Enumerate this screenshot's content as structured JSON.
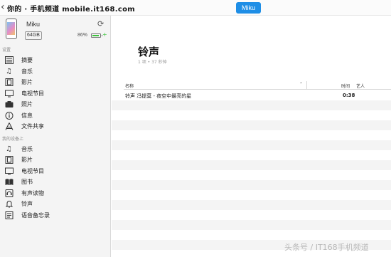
{
  "topbar": {
    "watermark": "你的 · 手机频道 mobile.it168.com",
    "device_button": "Miku"
  },
  "device": {
    "name": "Miku",
    "capacity": "64GB",
    "battery_percent": "86%",
    "battery_level": 0.86
  },
  "sidebar": {
    "settings_label": "设置",
    "settings_items": [
      {
        "label": "摘要",
        "icon": "summary-icon"
      },
      {
        "label": "音乐",
        "icon": "music-icon"
      },
      {
        "label": "影片",
        "icon": "film-icon"
      },
      {
        "label": "电视节目",
        "icon": "tv-icon"
      },
      {
        "label": "照片",
        "icon": "camera-icon"
      },
      {
        "label": "信息",
        "icon": "info-icon"
      },
      {
        "label": "文件共享",
        "icon": "apps-icon"
      }
    ],
    "ondevice_label": "我的设备上",
    "ondevice_items": [
      {
        "label": "音乐",
        "icon": "music-icon"
      },
      {
        "label": "影片",
        "icon": "film-icon"
      },
      {
        "label": "电视节目",
        "icon": "tv-icon"
      },
      {
        "label": "图书",
        "icon": "book-icon"
      },
      {
        "label": "有声读物",
        "icon": "audiobook-icon"
      },
      {
        "label": "铃声",
        "icon": "bell-icon"
      },
      {
        "label": "语音备忘录",
        "icon": "memo-icon"
      }
    ]
  },
  "main": {
    "title": "铃声",
    "subtitle": "1 项 • 37 秒钟",
    "columns": {
      "name": "名称",
      "time": "时间",
      "artist": "艺人"
    },
    "rows": [
      {
        "name": "铃声 冯提莫 - 夜空中最亮的星",
        "time": "0:38"
      }
    ]
  },
  "watermark_bottom": "头条号 / IT168手机频道"
}
